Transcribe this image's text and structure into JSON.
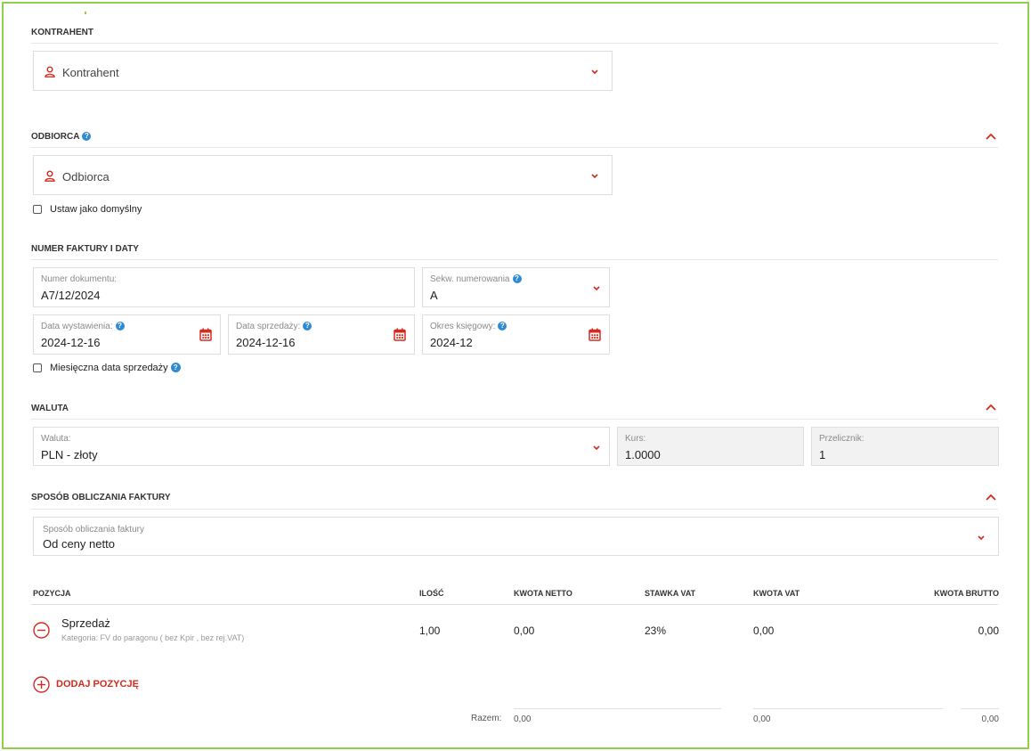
{
  "contractor": {
    "section_title": "KONTRAHENT",
    "select_placeholder": "Kontrahent"
  },
  "recipient": {
    "section_title": "ODBIORCA",
    "select_placeholder": "Odbiorca",
    "set_default_label": "Ustaw jako domyślny"
  },
  "invoice_numbers": {
    "section_title": "NUMER FAKTURY I DATY",
    "doc_number_label": "Numer dokumentu:",
    "doc_number_value": "A7/12/2024",
    "sequence_label": "Sekw. numerowania",
    "sequence_value": "A",
    "issue_date_label": "Data wystawienia:",
    "issue_date_value": "2024-12-16",
    "sale_date_label": "Data sprzedaży:",
    "sale_date_value": "2024-12-16",
    "accounting_period_label": "Okres księgowy:",
    "accounting_period_value": "2024-12",
    "monthly_sale_date_label": "Miesięczna data sprzedaży"
  },
  "currency": {
    "section_title": "WALUTA",
    "currency_label": "Waluta:",
    "currency_value": "PLN - złoty",
    "rate_label": "Kurs:",
    "rate_value": "1.0000",
    "converter_label": "Przelicznik:",
    "converter_value": "1"
  },
  "calc_method": {
    "section_title": "SPOSÓB OBLICZANIA FAKTURY",
    "field_label": "Sposób obliczania faktury",
    "field_value": "Od ceny netto"
  },
  "positions": {
    "headers": {
      "position": "POZYCJA",
      "qty": "ILOŚĆ",
      "net": "KWOTA NETTO",
      "vat_rate": "STAWKA VAT",
      "vat_amount": "KWOTA VAT",
      "gross": "KWOTA BRUTTO"
    },
    "rows": [
      {
        "name": "Sprzedaż",
        "category": "Kategoria: FV do paragonu ( bez Kpir , bez rej.VAT)",
        "qty": "1,00",
        "net": "0,00",
        "vat_rate": "23%",
        "vat_amount": "0,00",
        "gross": "0,00"
      }
    ],
    "add_label": "DODAJ POZYCJĘ",
    "totals": {
      "label": "Razem:",
      "net": "0,00",
      "vat": "0,00",
      "gross": "0,00"
    }
  },
  "colors": {
    "accent": "#d62a1e",
    "help": "#2e8bd3",
    "frame": "#8ed04a"
  }
}
